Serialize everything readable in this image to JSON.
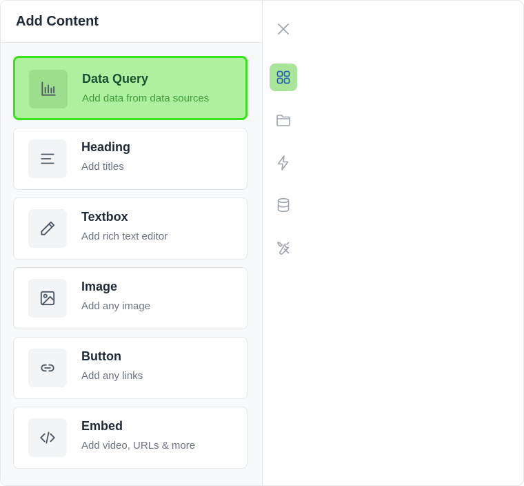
{
  "panel": {
    "title": "Add Content",
    "items": [
      {
        "icon": "bar-chart-icon",
        "title": "Data Query",
        "subtitle": "Add data from data sources",
        "selected": true
      },
      {
        "icon": "text-align-icon",
        "title": "Heading",
        "subtitle": "Add titles"
      },
      {
        "icon": "pencil-icon",
        "title": "Textbox",
        "subtitle": "Add rich text editor"
      },
      {
        "icon": "image-icon",
        "title": "Image",
        "subtitle": "Add any image"
      },
      {
        "icon": "link-icon",
        "title": "Button",
        "subtitle": "Add any links"
      },
      {
        "icon": "code-icon",
        "title": "Embed",
        "subtitle": "Add video, URLs & more"
      }
    ]
  },
  "rail": {
    "items": [
      {
        "icon": "close-icon"
      },
      {
        "icon": "grid-icon",
        "active": true
      },
      {
        "icon": "folder-icon"
      },
      {
        "icon": "lightning-icon"
      },
      {
        "icon": "database-icon"
      },
      {
        "icon": "tools-icon"
      }
    ]
  },
  "colors": {
    "selected_fill": "#aef0a0",
    "selected_border": "#39e21f",
    "rail_active": "#a8e59a"
  }
}
